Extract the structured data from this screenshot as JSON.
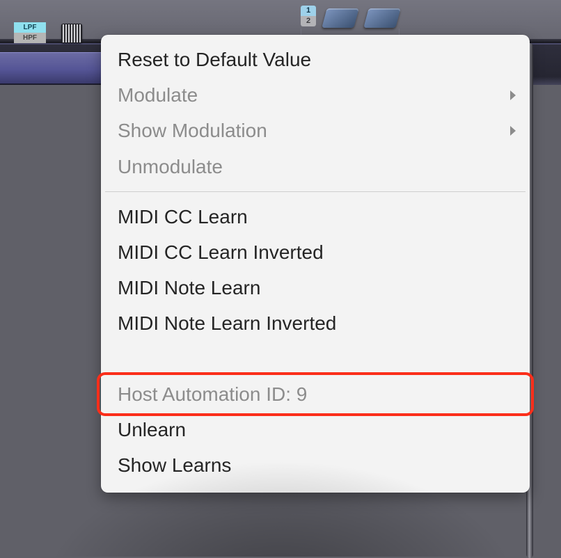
{
  "filter": {
    "active_label": "LPF",
    "inactive_label": "HPF"
  },
  "layer_selector": {
    "active": "1",
    "inactive": "2"
  },
  "menu": {
    "items": [
      {
        "key": "reset",
        "label": "Reset to Default Value",
        "disabled": false,
        "submenu": false
      },
      {
        "key": "modulate",
        "label": "Modulate",
        "disabled": true,
        "submenu": true
      },
      {
        "key": "show_modulation",
        "label": "Show Modulation",
        "disabled": true,
        "submenu": true
      },
      {
        "key": "unmodulate",
        "label": "Unmodulate",
        "disabled": true,
        "submenu": false
      },
      {
        "sep": true
      },
      {
        "key": "cc_learn",
        "label": "MIDI CC Learn",
        "disabled": false,
        "submenu": false
      },
      {
        "key": "cc_learn_inv",
        "label": "MIDI CC Learn Inverted",
        "disabled": false,
        "submenu": false
      },
      {
        "key": "note_learn",
        "label": "MIDI Note Learn",
        "disabled": false,
        "submenu": false
      },
      {
        "key": "note_learn_inv",
        "label": "MIDI Note Learn Inverted",
        "disabled": false,
        "submenu": false
      },
      {
        "blank": true
      },
      {
        "key": "host_auto_id",
        "label": "Host Automation ID: 9",
        "disabled": true,
        "submenu": false,
        "highlighted": true
      },
      {
        "key": "unlearn",
        "label": "Unlearn",
        "disabled": false,
        "submenu": false
      },
      {
        "key": "show_learns",
        "label": "Show Learns",
        "disabled": false,
        "submenu": false
      }
    ]
  }
}
